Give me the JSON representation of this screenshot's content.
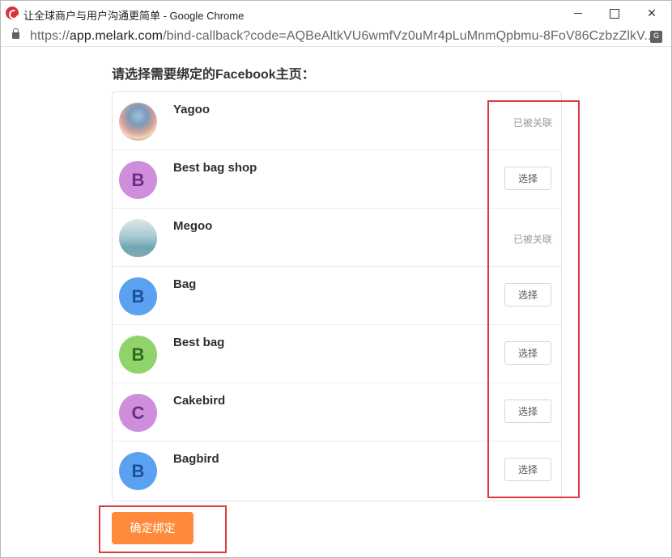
{
  "window": {
    "title": "让全球商户与用户沟通更简单 - Google Chrome"
  },
  "address_bar": {
    "url_scheme": "https://",
    "url_host": "app.melark.com",
    "url_path": "/bind-callback?code=AQBeAltkVU6wmfVz0uMr4pLuMnmQpbmu-8FoV86CzbzZlkV..."
  },
  "page": {
    "heading": "请选择需要绑定的Facebook主页：",
    "confirm_label": "确定绑定",
    "pages": [
      {
        "name": "Yagoo",
        "avatar_type": "photo",
        "status": "已被关联"
      },
      {
        "name": "Best bag shop",
        "avatar_type": "letter",
        "avatar_letter": "B",
        "avatar_bg": "#cf8edb",
        "avatar_fg": "#6a2e83",
        "action": "选择"
      },
      {
        "name": "Megoo",
        "avatar_type": "photo",
        "status": "已被关联"
      },
      {
        "name": "Bag",
        "avatar_type": "letter",
        "avatar_letter": "B",
        "avatar_bg": "#5aa2f0",
        "avatar_fg": "#1c4f9c",
        "action": "选择"
      },
      {
        "name": "Best bag",
        "avatar_type": "letter",
        "avatar_letter": "B",
        "avatar_bg": "#8fd36a",
        "avatar_fg": "#2e6b1e",
        "action": "选择"
      },
      {
        "name": "Cakebird",
        "avatar_type": "letter",
        "avatar_letter": "C",
        "avatar_bg": "#cf8edb",
        "avatar_fg": "#6a2e83",
        "action": "选择"
      },
      {
        "name": "Bagbird",
        "avatar_type": "letter",
        "avatar_letter": "B",
        "avatar_bg": "#5aa2f0",
        "avatar_fg": "#1c4f9c",
        "action": "选择"
      }
    ]
  },
  "colors": {
    "confirm_button": "#ff8a3c",
    "annotation": "#e0393e"
  }
}
